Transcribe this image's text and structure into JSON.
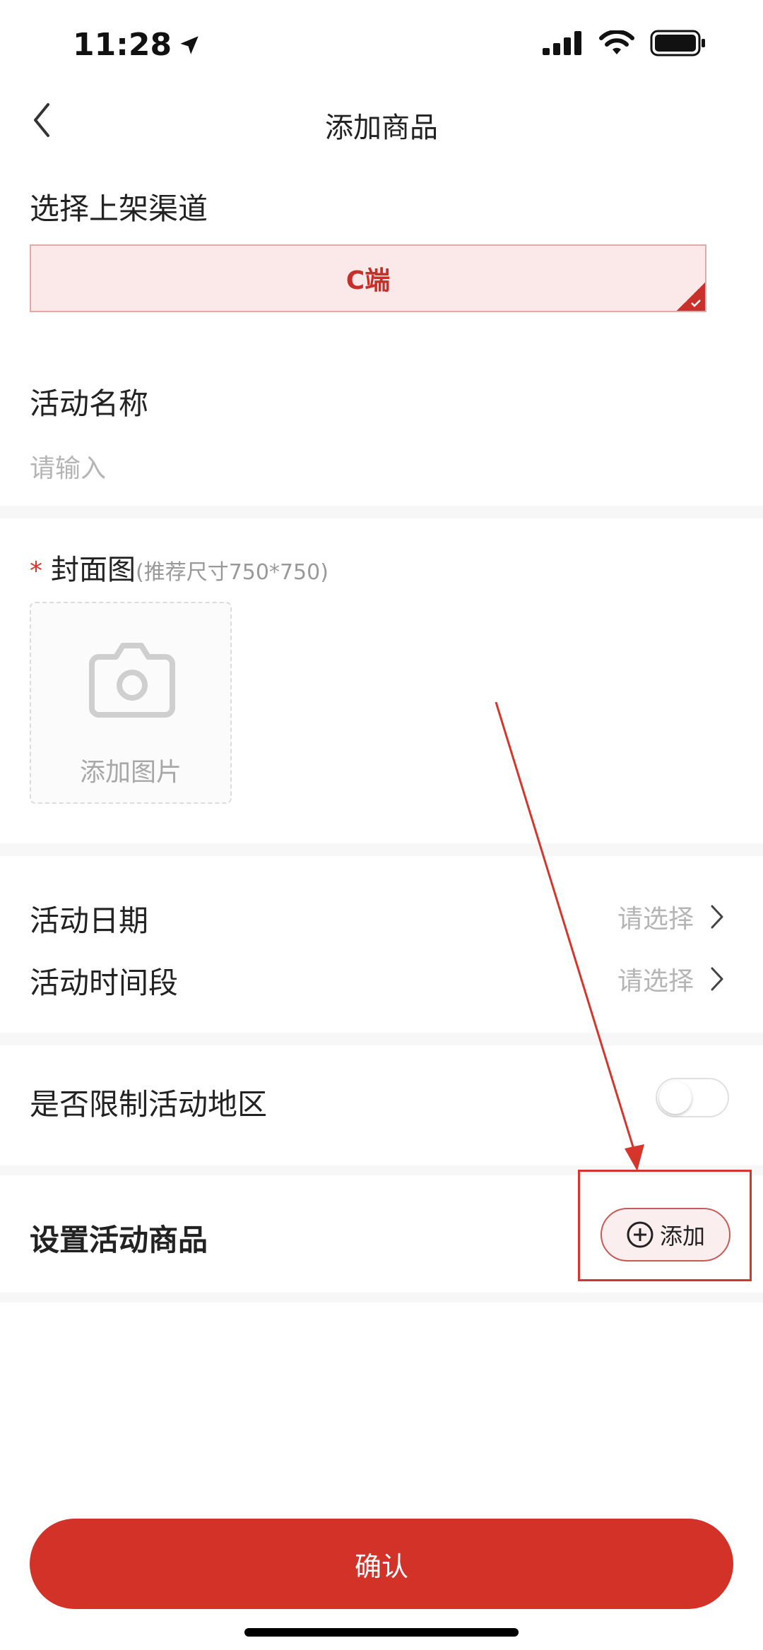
{
  "status_bar": {
    "time": "11:28"
  },
  "nav": {
    "title": "添加商品"
  },
  "channel": {
    "label": "选择上架渠道",
    "option": "C端"
  },
  "activity_name": {
    "label": "活动名称",
    "placeholder": "请输入"
  },
  "cover": {
    "required_mark": "*",
    "label": "封面图",
    "hint": "(推荐尺寸750*750)",
    "upload_text": "添加图片"
  },
  "activity_date": {
    "label": "活动日期",
    "value": "请选择"
  },
  "activity_time": {
    "label": "活动时间段",
    "value": "请选择"
  },
  "region_limit": {
    "label": "是否限制活动地区"
  },
  "products": {
    "label": "设置活动商品",
    "add_label": "添加"
  },
  "confirm": {
    "label": "确认"
  },
  "colors": {
    "accent": "#d23228",
    "chip_bg": "#fbe9e9",
    "placeholder": "#b5b5b5"
  }
}
